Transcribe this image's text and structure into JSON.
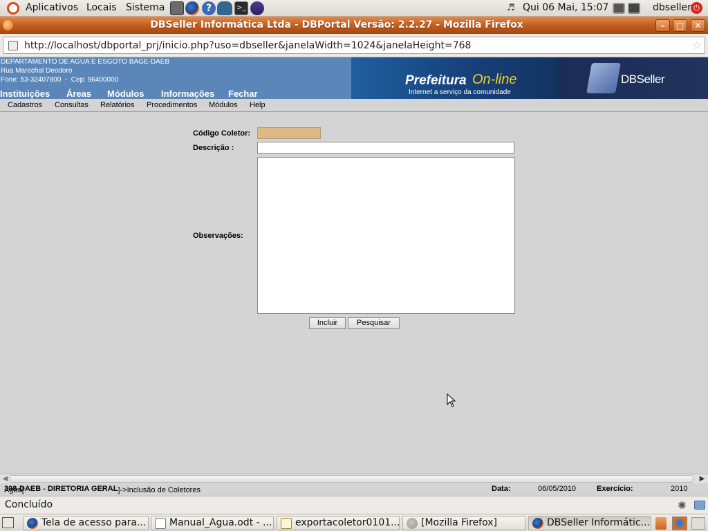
{
  "gnome_panel": {
    "menus": [
      "Aplicativos",
      "Locais",
      "Sistema"
    ],
    "datetime": "Qui 06 Mai, 15:07",
    "user": "dbseller",
    "icons": [
      "ubuntu-logo-icon",
      "calculator-icon",
      "firefox-icon",
      "help-icon",
      "postgres-icon",
      "terminal-icon",
      "eclipse-icon",
      "volume-icon",
      "network-icon",
      "display-icon",
      "power-icon"
    ]
  },
  "window": {
    "title": "DBSeller Informática Ltda - DBPortal Versão: 2.2.27 - Mozilla Firefox",
    "buttons": [
      "minimize",
      "maximize",
      "close"
    ]
  },
  "browser": {
    "url": "http://localhost/dbportal_prj/inicio.php?uso=dbseller&janelaWidth=1024&janelaHeight=768",
    "status": "Concluído"
  },
  "header": {
    "org_name": "DEPARTAMENTO DE AGUA E ESGOTO BAGE-DAEB",
    "address": "Rua Marechal Deodoro",
    "phone": "Fone: 53-32407800  -  Cep: 96400000",
    "banner_brand": "Prefeitura",
    "banner_online": "On-line",
    "banner_tagline": "Internet a serviço da comunidade",
    "logo_text": "DBSeller",
    "menu": [
      "Instituições",
      "Áreas",
      "Módulos",
      "Informações",
      "Fechar"
    ]
  },
  "submenu": [
    "Cadastros",
    "Consultas",
    "Relatórios",
    "Procedimentos",
    "Módulos",
    "Help"
  ],
  "form": {
    "codigo_label": "Código Coletor:",
    "codigo_value": "",
    "descricao_label": "Descrição :",
    "descricao_value": "",
    "observacoes_label": "Observações:",
    "observacoes_value": "",
    "btn_incluir": "Incluir",
    "btn_pesquisar": "Pesquisar"
  },
  "info_bar": {
    "path_prefix": "Agua[",
    "path_bold": "308-DAEB - DIRETORIA GERAL",
    "path_suffix": "]->Inclusão de Coletores",
    "data_label": "Data:",
    "data_value": "06/05/2010",
    "exercicio_label": "Exercício:",
    "exercicio_value": "2010"
  },
  "taskbar": {
    "tasks": [
      "Tela de acesso para...",
      "Manual_Agua.odt - ...",
      "exportacoletor0101...",
      "[Mozilla Firefox]",
      "DBSeller Informátic..."
    ]
  },
  "colors": {
    "title_bar": "#c25a1c",
    "header_blue": "#5b86b9",
    "codigo_field_bg": "#deb887",
    "online_yellow": "#f2d21e"
  }
}
